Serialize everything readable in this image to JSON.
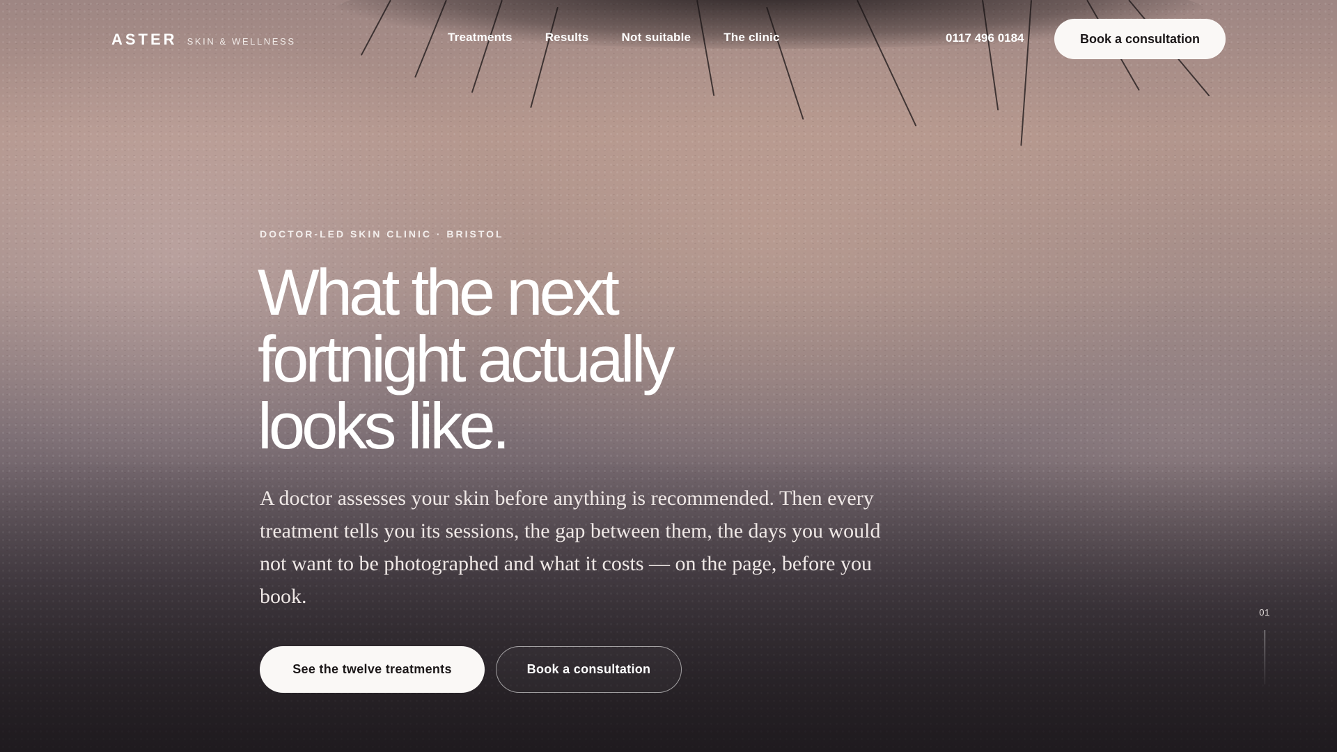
{
  "brand": {
    "name": "ASTER",
    "tagline": "SKIN & WELLNESS"
  },
  "nav": {
    "links": [
      {
        "label": "Treatments"
      },
      {
        "label": "Results"
      },
      {
        "label": "Not suitable"
      },
      {
        "label": "The clinic"
      }
    ],
    "phone": "0117 496 0184",
    "cta_label": "Book a consultation"
  },
  "hero": {
    "eyebrow": "DOCTOR-LED SKIN CLINIC · BRISTOL",
    "headline": "What the next fortnight actually looks like.",
    "lede": "A doctor assesses your skin before anything is recommended. Then every treatment tells you its sessions, the gap between them, the days you would not want to be photographed and what it costs — on the page, before you book.",
    "primary_button": "See the twelve treatments",
    "secondary_button": "Book a consultation",
    "slide_number": "01"
  },
  "background": {
    "image_subject": "macro-skin-eyelash-photo"
  }
}
